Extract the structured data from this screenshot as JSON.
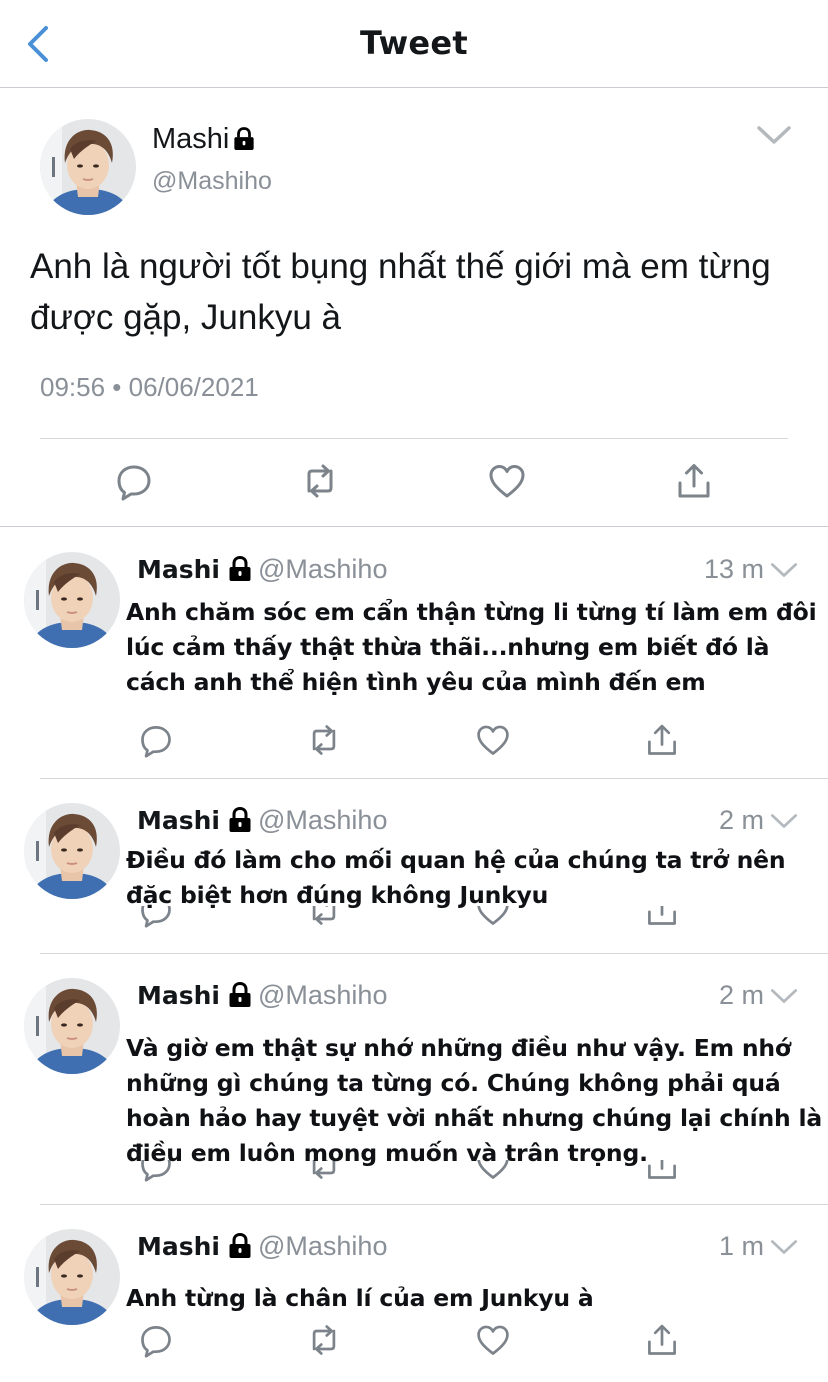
{
  "header": {
    "title": "Tweet"
  },
  "main_tweet": {
    "name": "Mashi",
    "handle": "@Mashiho",
    "text": "Anh là người tốt bụng nhất thế giới mà em từng được gặp, Junkyu à",
    "timestamp": "09:56 • 06/06/2021"
  },
  "replies": [
    {
      "name": "Mashi",
      "handle": "@Mashiho",
      "time": "13 m",
      "text": "Anh chăm sóc em cẩn thận từng li từng tí làm em đôi lúc cảm thấy thật thừa thãi...nhưng em biết đó là cách anh thể hiện tình yêu của mình đến em"
    },
    {
      "name": "Mashi",
      "handle": "@Mashiho",
      "time": "2 m",
      "text": "Điều đó làm cho mối quan hệ của chúng ta trở nên đặc biệt hơn đúng không Junkyu"
    },
    {
      "name": "Mashi",
      "handle": "@Mashiho",
      "time": "2 m",
      "text": "Và giờ em thật sự nhớ những điều như vậy. Em nhớ những gì chúng ta từng có. Chúng không phải quá hoàn hảo hay tuyệt vời nhất nhưng chúng lại chính là điều em luôn mong muốn và trân trọng."
    },
    {
      "name": "Mashi",
      "handle": "@Mashiho",
      "time": "1 m",
      "text": "Anh từng là chân lí của em Junkyu à"
    }
  ],
  "colors": {
    "text": "#14171a",
    "secondary": "#8a9097",
    "back_arrow": "#4a90d6",
    "divider": "#d4d7da"
  },
  "icons": [
    "back-arrow-icon",
    "lock-icon",
    "chevron-down-icon",
    "reply-icon",
    "retweet-icon",
    "like-icon",
    "share-icon"
  ]
}
